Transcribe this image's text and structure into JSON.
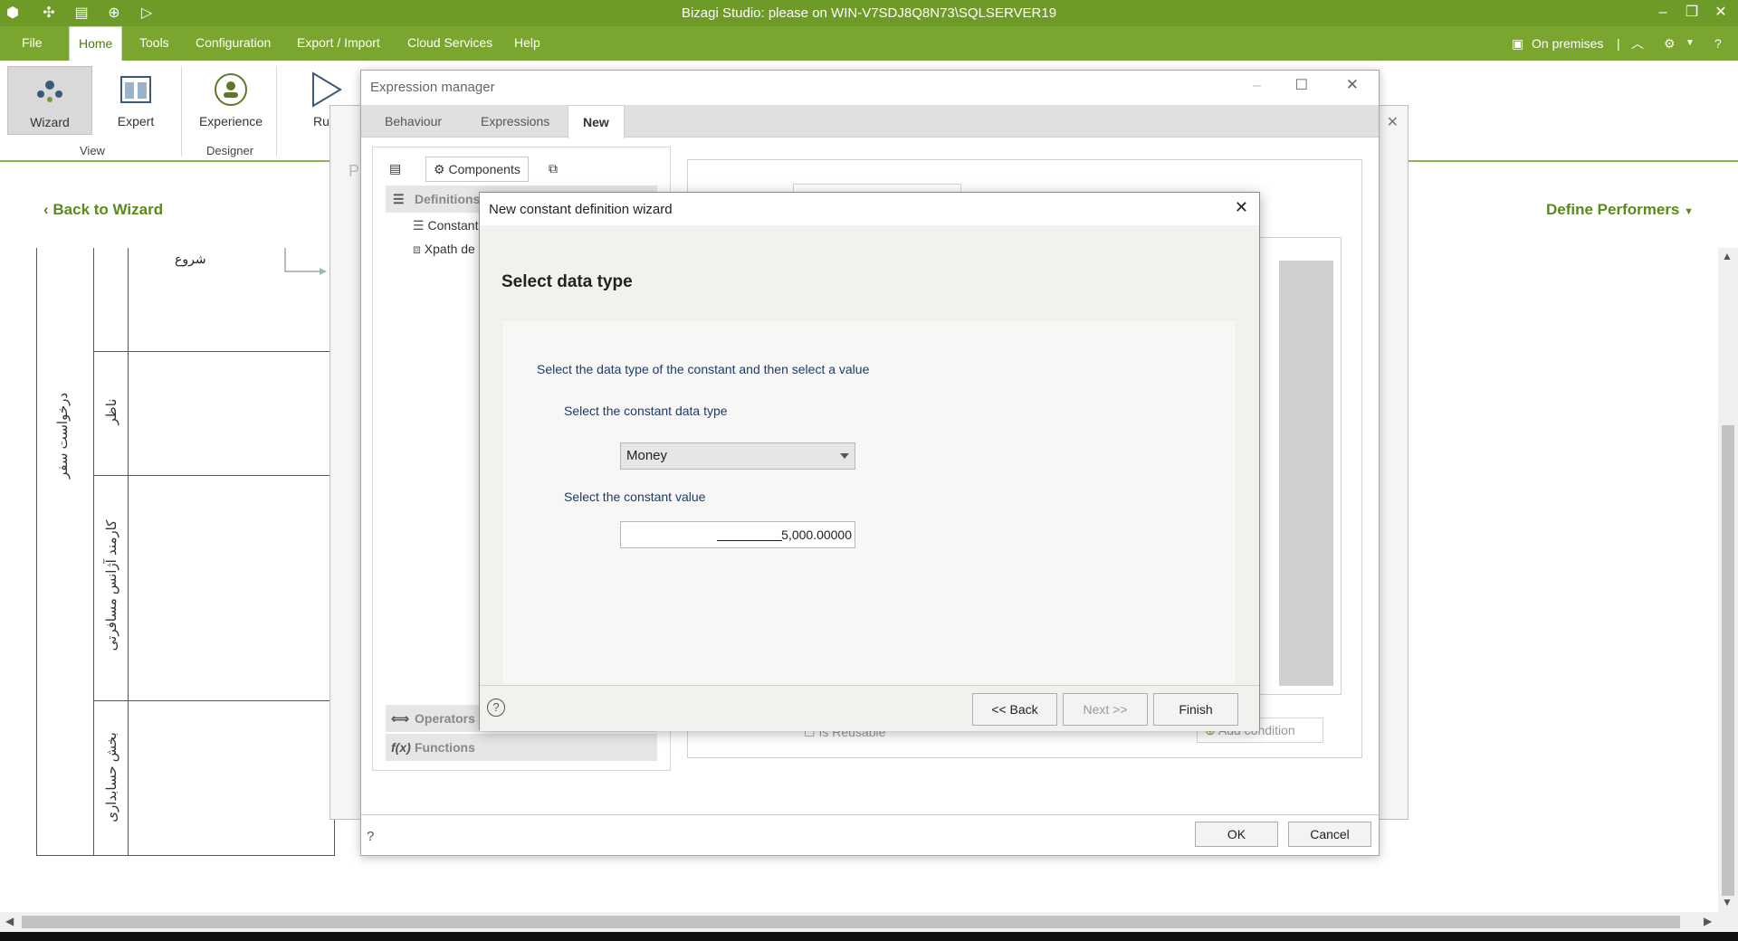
{
  "window": {
    "title": "Bizagi Studio: please  on WIN-V7SDJ8Q8N73\\SQLSERVER19"
  },
  "ribbon": {
    "tabs": [
      "File",
      "Home",
      "Tools",
      "Configuration",
      "Export / Import",
      "Cloud Services",
      "Help"
    ],
    "active_tab": "Home",
    "on_premises": "On premises",
    "buttons": {
      "wizard": "Wizard",
      "expert": "Expert",
      "experience": "Experience",
      "run": "Ru"
    },
    "groups": {
      "view": "View",
      "designer": "Designer"
    }
  },
  "workspace": {
    "back_to_wizard": "Back to Wizard",
    "define_performers": "Define Performers",
    "pool_name": "درخواست سفر",
    "start_label": "شروع",
    "lanes": [
      "ناظر",
      "کارمند آژانس مسافرتی",
      "بخش حسابداری"
    ],
    "bg_letter": "P"
  },
  "expression_manager": {
    "title": "Expression manager",
    "tabs": [
      "Behaviour",
      "Expressions",
      "New"
    ],
    "active_tab": "New",
    "left_tabs": {
      "components": "Components"
    },
    "sections": {
      "definitions": "Definitions",
      "operators": "Operators",
      "functions": "Functions"
    },
    "items": [
      "Constant",
      "Xpath de"
    ],
    "is_reusable": "Is Reusable",
    "add_condition": "Add condition",
    "ok": "OK",
    "cancel": "Cancel"
  },
  "wizard": {
    "title": "New constant definition wizard",
    "heading": "Select data type",
    "instruction": "Select the data type of the constant and then select a value",
    "type_label": "Select the constant data type",
    "type_value": "Money",
    "value_label": "Select the constant value",
    "value": "5,000.00000",
    "back": "<< Back",
    "next": "Next >>",
    "finish": "Finish"
  },
  "colors": {
    "brand_green": "#6e9a27",
    "link_green": "#5a8a1a",
    "label_blue": "#1f3a6a"
  }
}
